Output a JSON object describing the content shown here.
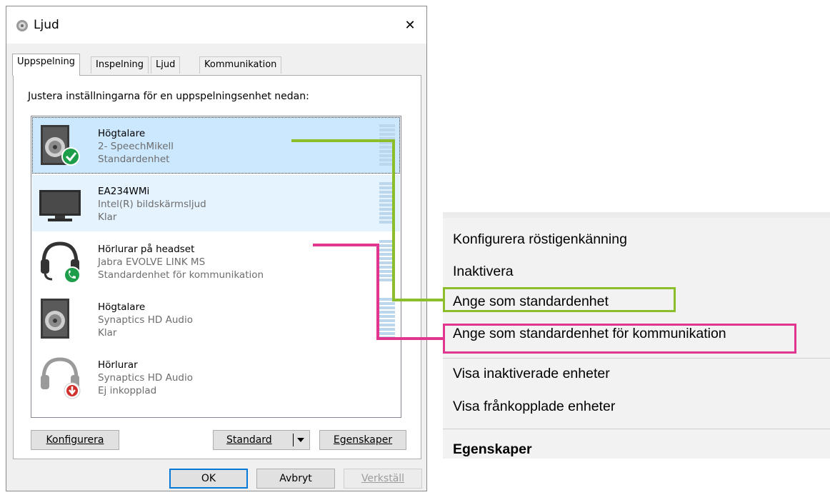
{
  "dialog": {
    "title": "Ljud",
    "close_glyph": "✕",
    "tabs": [
      "Uppspelning",
      "Inspelning",
      "Ljud",
      "Kommunikation"
    ],
    "instruction": "Justera inställningarna för en uppspelningsenhet nedan:",
    "devices": [
      {
        "name": "Högtalare",
        "line2": "2- SpeechMikell",
        "line3": "Standardenhet",
        "icon": "speaker-icon",
        "badge": "green-check-badge-icon",
        "state": "selected"
      },
      {
        "name": "EA234WMi",
        "line2": "Intel(R) bildskärmsljud",
        "line3": "Klar",
        "icon": "monitor-icon",
        "badge": "",
        "state": "hover"
      },
      {
        "name": "Hörlurar på headset",
        "line2": "Jabra EVOLVE LINK MS",
        "line3": "Standardenhet för kommunikation",
        "icon": "headset-icon",
        "badge": "green-phone-badge-icon",
        "state": "normal"
      },
      {
        "name": "Högtalare",
        "line2": "Synaptics HD Audio",
        "line3": "Klar",
        "icon": "speaker-icon",
        "badge": "",
        "state": "normal"
      },
      {
        "name": "Hörlurar",
        "line2": "Synaptics HD Audio",
        "line3": "Ej inkopplad",
        "icon": "headphones-icon",
        "badge": "red-down-arrow-badge-icon",
        "state": "normal"
      }
    ],
    "buttons": {
      "configure": "Konfigurera",
      "standard": "Standard",
      "properties": "Egenskaper",
      "ok": "OK",
      "cancel": "Avbryt",
      "apply": "Verkställ"
    }
  },
  "context_menu": {
    "items": [
      "Konfigurera röstigenkänning",
      "Inaktivera",
      "Ange som standardenhet",
      "Ange som standardenhet för kommunikation",
      "Visa inaktiverade enheter",
      "Visa frånkopplade enheter",
      "Egenskaper"
    ]
  },
  "colors": {
    "selection": "#cce8ff",
    "hover": "#e5f3ff",
    "green_highlight": "#8cbd2a",
    "pink_highlight": "#e0368f",
    "default_button_border": "#0078d7"
  }
}
